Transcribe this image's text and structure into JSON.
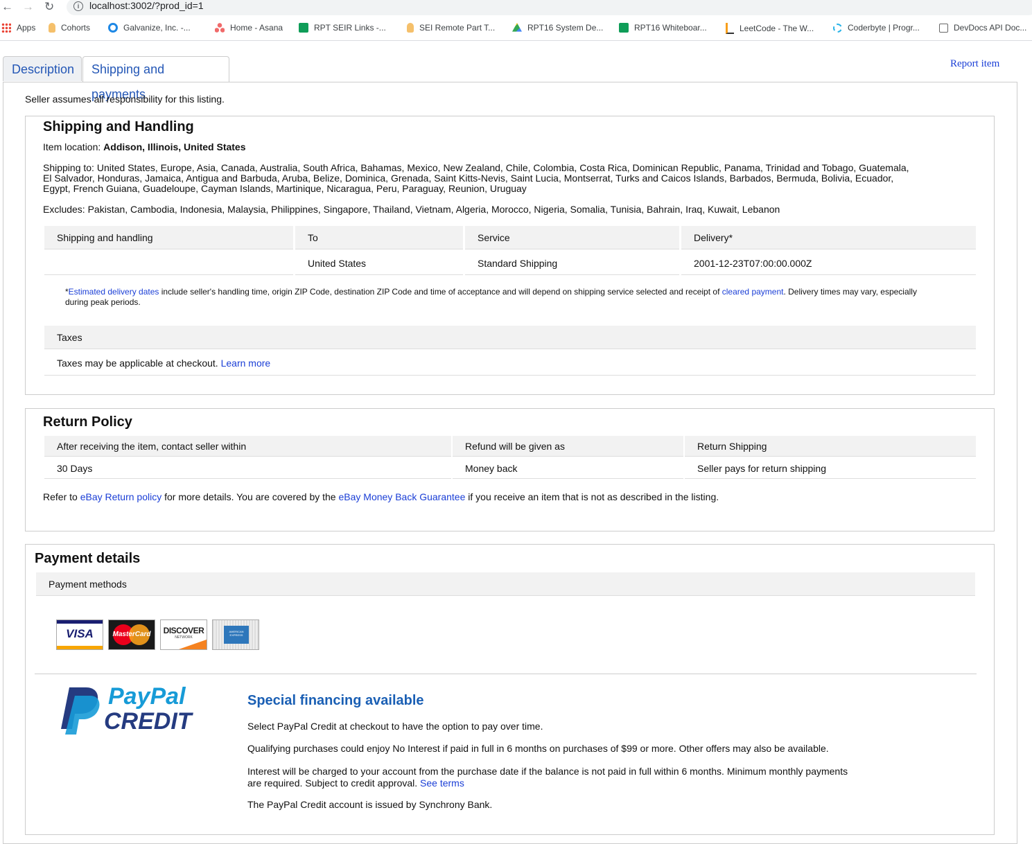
{
  "browser": {
    "url": "localhost:3002/?prod_id=1",
    "bookmarks": [
      "Apps",
      "Cohorts",
      "Galvanize, Inc. -...",
      "Home - Asana",
      "RPT SEIR Links -...",
      "SEI Remote Part T...",
      "RPT16 System De...",
      "RPT16 Whiteboar...",
      "LeetCode - The W...",
      "Coderbyte | Progr...",
      "DevDocs API Doc..."
    ]
  },
  "tabs": {
    "description": "Description",
    "shipping": "Shipping and payments"
  },
  "report_item": "Report item",
  "seller_note": "Seller assumes all responsibility for this listing.",
  "shipping": {
    "title": "Shipping and Handling",
    "location_label": "Item location:",
    "location": "Addison, Illinois, United States",
    "ship_to_line1": "Shipping to: United States, Europe, Asia, Canada, Australia, South Africa, Bahamas, Mexico, New Zealand, Chile, Colombia, Costa Rica, Dominican Republic, Panama, Trinidad and Tobago, Guatemala,",
    "ship_to_line2": "El Salvador, Honduras, Jamaica, Antigua and Barbuda, Aruba, Belize, Dominica, Grenada, Saint Kitts-Nevis, Saint Lucia, Montserrat, Turks and Caicos Islands, Barbados, Bermuda, Bolivia, Ecuador,",
    "ship_to_line3": "Egypt, French Guiana, Guadeloupe, Cayman Islands, Martinique, Nicaragua, Peru, Paraguay, Reunion, Uruguay",
    "excludes": "Excludes: Pakistan, Cambodia, Indonesia, Malaysia, Philippines, Singapore, Thailand, Vietnam, Algeria, Morocco, Nigeria, Somalia, Tunisia, Bahrain, Iraq, Kuwait, Lebanon",
    "headers": [
      "Shipping and handling",
      "To",
      "Service",
      "Delivery*"
    ],
    "row": [
      "",
      "United States",
      "Standard Shipping",
      "2001-12-23T07:00:00.000Z"
    ],
    "footnote_star": "*",
    "footnote_link1": "Estimated delivery dates",
    "footnote_mid": " include seller's handling time, origin ZIP Code, destination ZIP Code and time of acceptance and will depend on shipping service selected and receipt of ",
    "footnote_link2": "cleared payment",
    "footnote_end": ". Delivery times may vary, especially",
    "footnote_line2": "during peak periods.",
    "taxes_header": "Taxes",
    "taxes_text": "Taxes may be applicable at checkout.",
    "taxes_link": "Learn more"
  },
  "returns": {
    "title": "Return Policy",
    "headers": [
      "After receiving the item, contact seller within",
      "Refund will be given as",
      "Return Shipping"
    ],
    "row": [
      "30 Days",
      "Money back",
      "Seller pays for return shipping"
    ],
    "refer_pre": "Refer to ",
    "refer_link1": "eBay Return policy",
    "refer_mid": " for more details. You are covered by the ",
    "refer_link2": "eBay Money Back Guarantee",
    "refer_end": " if you receive an item that is not as described in the listing."
  },
  "payment": {
    "title": "Payment details",
    "methods_header": "Payment methods",
    "cards": [
      "VISA",
      "MasterCard",
      "DISCOVER",
      "AMERICAN EXPRESS"
    ],
    "discover_sub": "NETWORK",
    "paypal_logo_line1": "PayPal",
    "paypal_logo_line2": "CREDIT",
    "financing_title": "Special financing available",
    "p1": "Select PayPal Credit at checkout to have the option to pay over time.",
    "p2": "Qualifying purchases could enjoy No Interest if paid in full in 6 months on purchases of $99 or more. Other offers may also be available.",
    "p3_line1": "Interest will be charged to your account from the purchase date if the balance is not paid in full within 6 months. Minimum monthly payments",
    "p3_line2": "are required. Subject to credit approval.",
    "p3_link": "See terms",
    "p4": "The PayPal Credit account is issued by Synchrony Bank."
  },
  "colors": {
    "link": "#1a3ed6",
    "paypal_blue": "#1a5fb4",
    "header_bg": "#f2f2f2"
  }
}
